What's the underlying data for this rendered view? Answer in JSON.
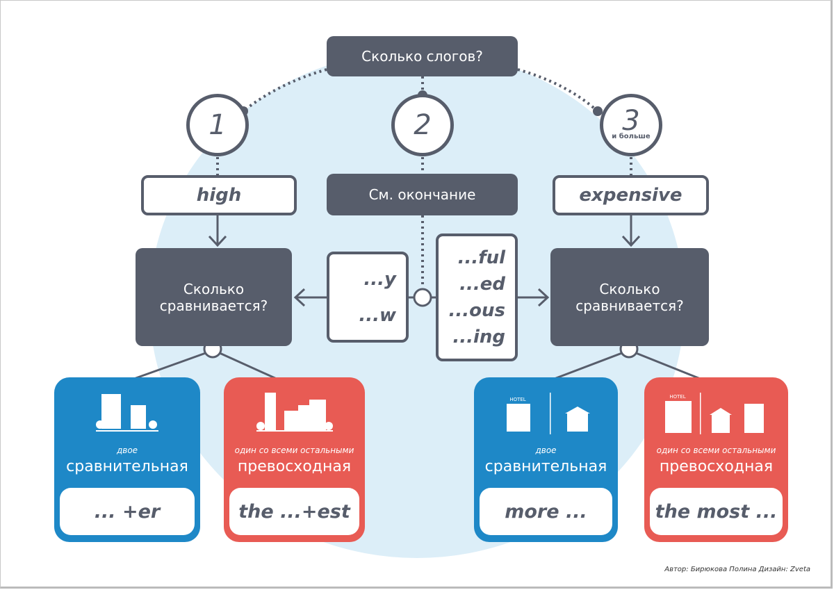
{
  "question": "Сколько слогов?",
  "syllables": [
    {
      "num": "1"
    },
    {
      "num": "2"
    },
    {
      "num": "3",
      "note": "и больше"
    }
  ],
  "examples": {
    "one": "high",
    "two": "См. окончание",
    "three": "expensive"
  },
  "how_many": "Сколько сравнивается?",
  "endings_left": [
    "...y",
    "...w"
  ],
  "endings_right": [
    "...ful",
    "...ed",
    "...ous",
    "...ing"
  ],
  "cards": [
    {
      "sub": "двое",
      "main": "сравнительная",
      "formula": "... +er",
      "icon": "buildings-icon"
    },
    {
      "sub": "один со всеми остальными",
      "main": "превосходная",
      "formula": "the   ...+est",
      "icon": "city-icon"
    },
    {
      "sub": "двое",
      "main": "сравнительная",
      "formula": "more ...",
      "icon": "hotels-icon",
      "hotel": "HOTEL"
    },
    {
      "sub": "один со всеми остальными",
      "main": "превосходная",
      "formula": "the most ...",
      "icon": "hotels-icon",
      "hotel": "HOTEL"
    }
  ],
  "credit": "Автор: Бирюкова Полина   Дизайн: Zveta",
  "colors": {
    "dark": "#575d6b",
    "blue": "#1e88c7",
    "red": "#e85b54",
    "bg_circle": "#dceef8"
  }
}
